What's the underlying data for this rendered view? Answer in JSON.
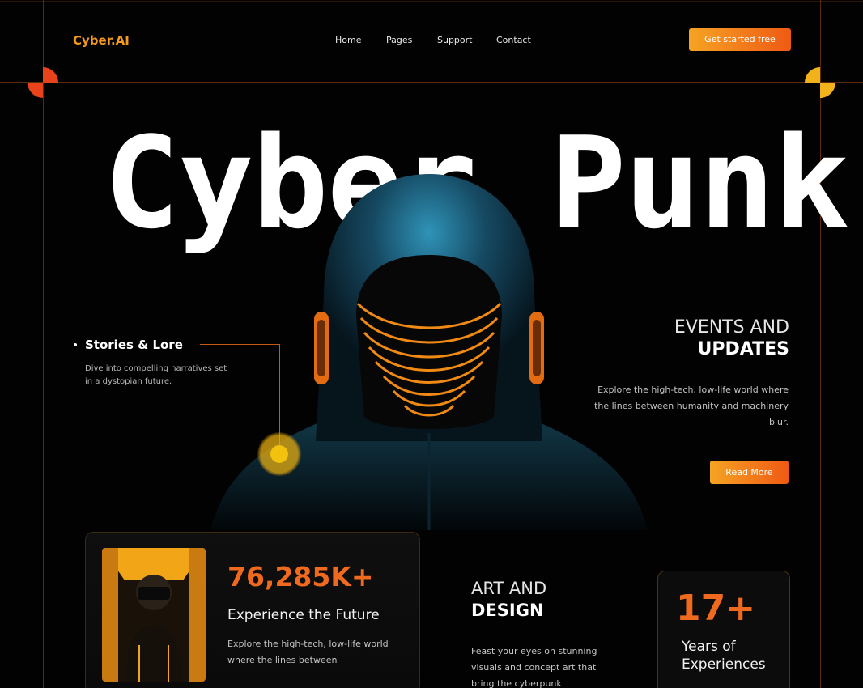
{
  "header": {
    "logo": "Cyber.AI",
    "nav": [
      "Home",
      "Pages",
      "Support",
      "Contact"
    ],
    "cta": "Get started free"
  },
  "hero": {
    "title": "Cyber Punk"
  },
  "stories": {
    "title": "Stories & Lore",
    "desc": "Dive into compelling narratives set in a dystopian future."
  },
  "events": {
    "line1": "EVENTS AND",
    "line2": "UPDATES",
    "desc": "Explore the high-tech, low-life world where the lines between humanity and machinery blur.",
    "button": "Read More"
  },
  "stat": {
    "value": "76,285K+",
    "title": "Experience the Future",
    "desc": "Explore the high-tech, low-life world where the lines between"
  },
  "art": {
    "line1": "ART AND",
    "line2": "DESIGN",
    "desc": "Feast your eyes on stunning visuals and concept art that bring the cyberpunk"
  },
  "years": {
    "value": "17+",
    "label": "Years of Experiences"
  },
  "colors": {
    "accent": "#ef6a1e",
    "accent_light": "#f6a323",
    "background": "#020202"
  }
}
